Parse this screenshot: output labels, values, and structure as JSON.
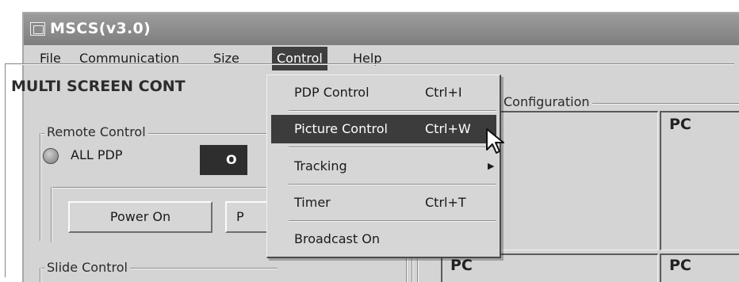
{
  "app": {
    "title": "MSCS(v3.0)",
    "icon": "app-monitor-icon"
  },
  "menubar": [
    {
      "label": "File",
      "underline": "F"
    },
    {
      "label": "Communication",
      "underline": "C"
    },
    {
      "label": "Size",
      "underline": "z"
    },
    {
      "label": "Control",
      "underline": "o",
      "active": true
    },
    {
      "label": "Help",
      "underline": "H"
    }
  ],
  "panel": {
    "title": "MULTI SCREEN CONT",
    "remote_control": {
      "label": "Remote Control",
      "all_pdp_label": "ALL PDP",
      "black_button_partial": "O",
      "power_on_label": "Power On",
      "power_partial_label": "P"
    },
    "slide_control_label": "Slide Control",
    "configuration_label": "Configuration"
  },
  "config_cells": [
    "PC",
    "PC",
    "PC"
  ],
  "control_menu": {
    "items": [
      {
        "label": "PDP Control",
        "shortcut": "Ctrl+I"
      },
      {
        "label": "Picture Control",
        "shortcut": "Ctrl+W",
        "highlighted": true
      },
      {
        "label": "Tracking",
        "shortcut": "",
        "submenu": true
      },
      {
        "label": "Timer",
        "shortcut": "Ctrl+T"
      },
      {
        "label": "Broadcast On",
        "shortcut": ""
      }
    ],
    "submenu_arrow": "submenu-arrow-icon"
  },
  "cursor": "mouse-pointer-icon"
}
